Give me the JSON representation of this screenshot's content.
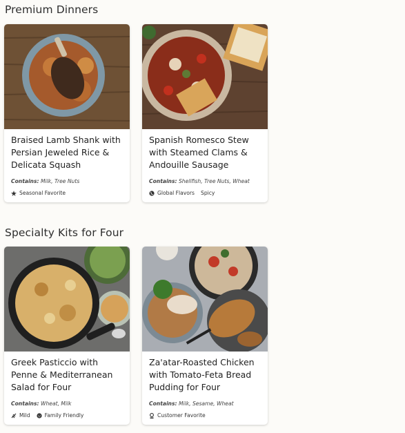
{
  "sections": [
    {
      "title": "Premium Dinners",
      "cards": [
        {
          "title": "Braised Lamb Shank with Persian Jeweled Rice & Delicata Squash",
          "allergens_label": "Contains:",
          "allergens": "Milk, Tree Nuts",
          "tags": [
            {
              "icon": "seasonal-icon",
              "label": "Seasonal Favorite"
            }
          ]
        },
        {
          "title": "Spanish Romesco Stew with Steamed Clams & Andouille Sausage",
          "allergens_label": "Contains:",
          "allergens": "Shellfish, Tree Nuts, Wheat",
          "tags": [
            {
              "icon": "globe-icon",
              "label": "Global Flavors"
            },
            {
              "icon": "",
              "label": "Spicy"
            }
          ]
        }
      ]
    },
    {
      "title": "Specialty Kits for Four",
      "cards": [
        {
          "title": "Greek Pasticcio with Penne & Mediterranean Salad for Four",
          "allergens_label": "Contains:",
          "allergens": "Wheat, Milk",
          "tags": [
            {
              "icon": "mild-icon",
              "label": "Mild"
            },
            {
              "icon": "smiley-icon",
              "label": "Family Friendly"
            }
          ]
        },
        {
          "title": "Za'atar-Roasted Chicken with Tomato-Feta Bread Pudding for Four",
          "allergens_label": "Contains:",
          "allergens": "Milk, Sesame, Wheat",
          "tags": [
            {
              "icon": "customer-icon",
              "label": "Customer Favorite"
            }
          ]
        }
      ]
    }
  ]
}
